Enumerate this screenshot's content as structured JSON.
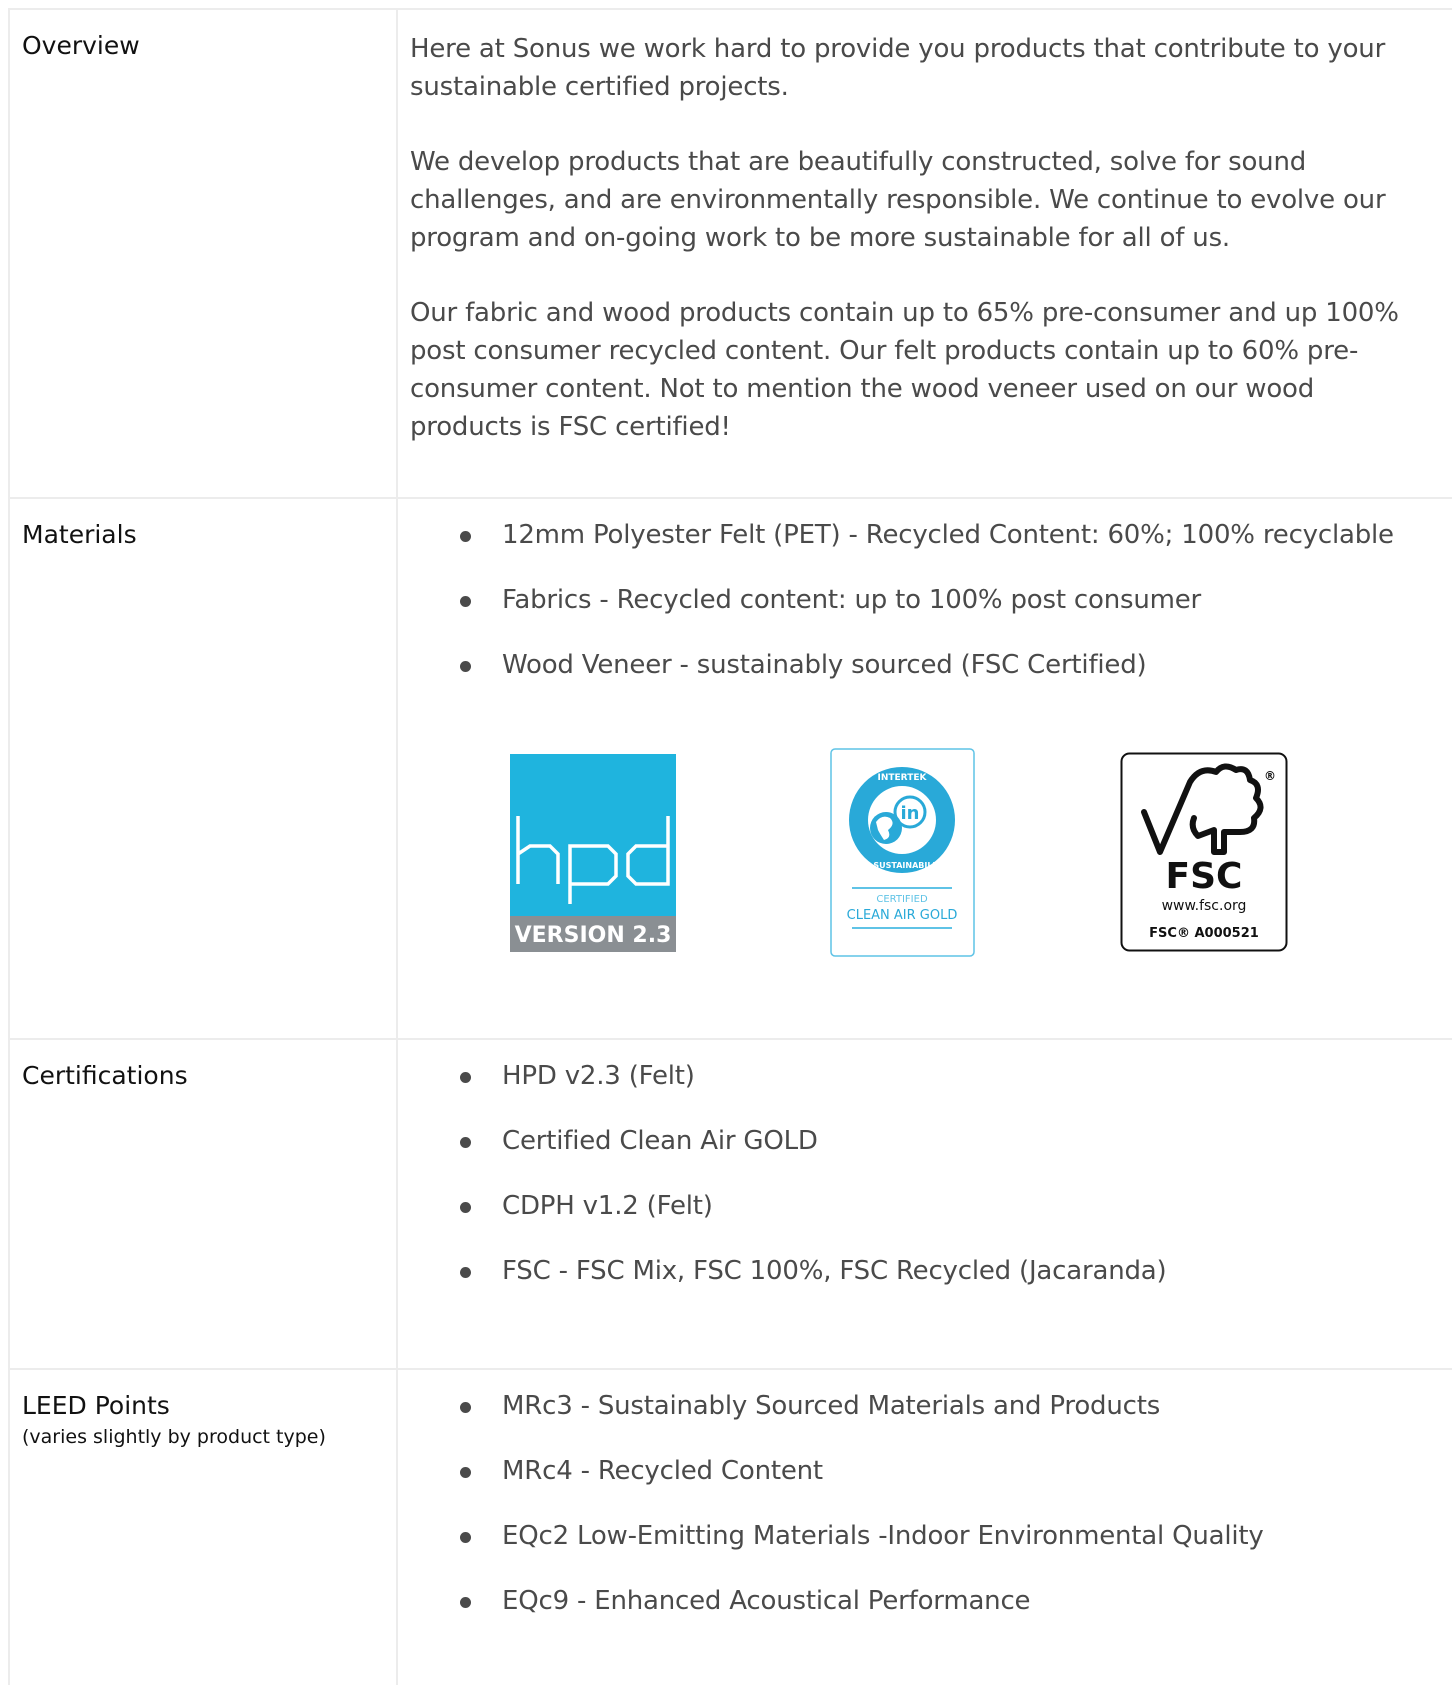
{
  "overview": {
    "label": "Overview",
    "paragraphs": [
      "Here at Sonus we work hard to provide you products that contribute to your sustainable certified projects.",
      "We develop products that are beautifully constructed, solve for sound challenges, and are environmentally responsible. We continue to evolve our program and on-going work to be more sustainable for all of us.",
      "Our fabric and wood products contain up to 65% pre-consumer and up 100% post consumer recycled content. Our felt products contain up to 60% pre-consumer content.  Not to mention the wood veneer used on our wood products is FSC certified!"
    ]
  },
  "materials": {
    "label": "Materials",
    "items": [
      "12mm Polyester Felt (PET) - Recycled Content: 60%; 100% recyclable",
      "Fabrics - Recycled content: up to 100% post consumer",
      "Wood Veneer - sustainably sourced (FSC Certified)"
    ],
    "logos": {
      "hpd": {
        "wordmark": "hpd",
        "version": "VERSION 2.3",
        "color": "#1fb4de"
      },
      "intertek": {
        "top_text": "INTERTEK",
        "bottom_text": "SUSTAINABILITY",
        "badge": "in",
        "line1": "CERTIFIED",
        "line2": "CLEAN AIR GOLD",
        "color": "#29a9d8"
      },
      "fsc": {
        "name": "FSC",
        "url": "www.fsc.org",
        "license": "FSC® A000521",
        "registered": "®"
      }
    }
  },
  "certifications": {
    "label": "Certifications",
    "items": [
      "HPD v2.3 (Felt)",
      "Certified Clean Air GOLD",
      "CDPH v1.2 (Felt)",
      "FSC - FSC Mix, FSC 100%, FSC Recycled (Jacaranda)"
    ]
  },
  "leed": {
    "label": "LEED Points",
    "sublabel": "(varies slightly by product type)",
    "items": [
      "MRc3 - Sustainably Sourced Materials and Products",
      "MRc4 - Recycled Content",
      "EQc2 Low-Emitting Materials -Indoor Environmental Quality",
      "EQc9  - Enhanced Acoustical Performance"
    ]
  }
}
